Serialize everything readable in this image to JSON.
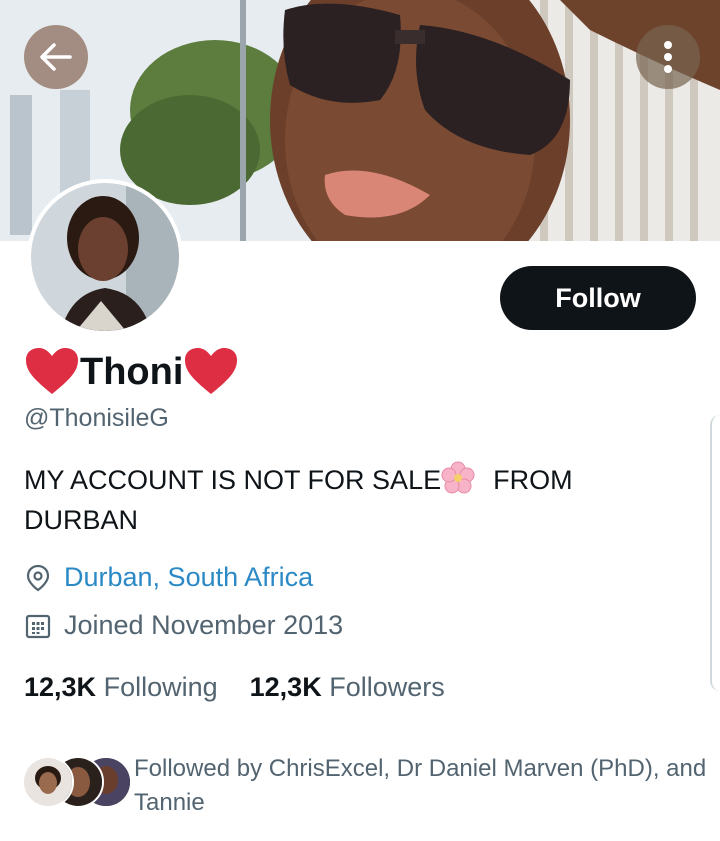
{
  "header": {
    "back_icon": "arrow-left-icon",
    "more_icon": "more-vertical-icon"
  },
  "profile": {
    "display_name": "Thoni",
    "handle": "@ThonisileG",
    "follow_label": "Follow",
    "bio_part1": "MY ACCOUNT IS NOT FOR SALE",
    "bio_part2": "FROM DURBAN",
    "location": "Durban, South Africa",
    "joined": "Joined November 2013",
    "following_count": "12,3K",
    "following_label": "Following",
    "followers_count": "12,3K",
    "followers_label": "Followers",
    "followed_by": "Followed by ChrisExcel, Dr Daniel Marven (PhD), and Tannie"
  },
  "colors": {
    "follow_bg": "#0f1419",
    "link": "#2b8ac6",
    "secondary_text": "#536471",
    "heart": "#dd2e44"
  }
}
